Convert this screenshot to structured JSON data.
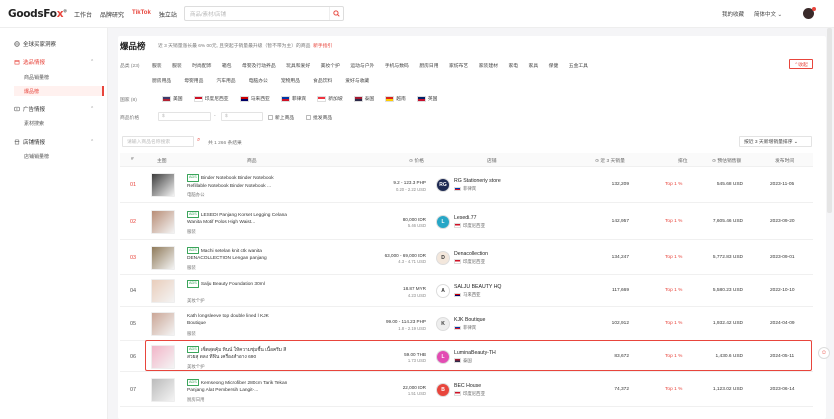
{
  "app": {
    "logo_main": "GoodsFo",
    "logo_accent": "x",
    "logo_tm": "®"
  },
  "topnav": [
    "工作台",
    "品牌研究",
    "TikTok",
    "独立站"
  ],
  "search": {
    "placeholder": "商品/素材/店铺"
  },
  "topright": {
    "favorites": "我的收藏",
    "language": "简体中文 ⌄"
  },
  "sidebar": {
    "items": [
      {
        "label": "全球买家洞察",
        "icon": "globe-icon"
      },
      {
        "label": "选品情报",
        "icon": "box-icon",
        "expanded": true
      },
      {
        "label": "广告情报",
        "icon": "ad-icon",
        "expanded": true
      },
      {
        "label": "店铺情报",
        "icon": "store-icon",
        "expanded": true
      }
    ],
    "sub_product": [
      "商品销量榜",
      "爆品榜"
    ],
    "sub_ads": [
      "素材搜索"
    ],
    "sub_store": [
      "店铺销量榜"
    ]
  },
  "page": {
    "title": "爆品榜",
    "subtitle": "近 3 天销量涨长最 6% 00元, 且突起于销量最升级（暂不带为主）的商品",
    "subtitle_link": "新手指引"
  },
  "filters": {
    "category_label": "品类 (23)",
    "categories_row1": [
      "服装",
      "服装",
      "时尚配饰",
      "箱包",
      "母婴及行动养品",
      "玩具和爱好",
      "美妆个护",
      "运动与户外",
      "手机与数码",
      "厨房日用",
      "家纺布艺",
      "家装建材",
      "家电",
      "家具",
      "保健",
      "五金工具"
    ],
    "categories_row2": [
      "厨房用品",
      "母婴用品",
      "汽车用品",
      "电脑办公",
      "宠物用品",
      "食品饮料",
      "爱好与收藏"
    ],
    "expand_label": "⌃收起",
    "country_label": "国家 (8)",
    "countries": [
      {
        "name": "美国",
        "colors": [
          "#3c3b6e",
          "#b22234"
        ]
      },
      {
        "name": "印度尼西亚",
        "colors": [
          "#ce1126",
          "#ffffff"
        ]
      },
      {
        "name": "马来西亚",
        "colors": [
          "#cc0001",
          "#010066"
        ]
      },
      {
        "name": "菲律宾",
        "colors": [
          "#0038a8",
          "#ce1126"
        ]
      },
      {
        "name": "新加坡",
        "colors": [
          "#ef3340",
          "#ffffff"
        ]
      },
      {
        "name": "泰国",
        "colors": [
          "#a51931",
          "#2d2a4a"
        ]
      },
      {
        "name": "越南",
        "colors": [
          "#da251d",
          "#ffcd00"
        ]
      },
      {
        "name": "英国",
        "colors": [
          "#012169",
          "#c8102e"
        ]
      }
    ],
    "price_label": "商品价格",
    "price_min_placeholder": "$",
    "price_max_placeholder": "$",
    "new_label": "新上商品",
    "agent_label": "批发商品"
  },
  "table": {
    "search_placeholder": "请输入商品名称搜索",
    "count_text": "共 1 266 条结果",
    "sort_label": "按近 3 天新增销量排序 ⌄",
    "headers": {
      "rank": "#",
      "thumb": "主图",
      "product": "商品",
      "price": "⊙ 价格",
      "store": "店铺",
      "sales": "⊙ 近 3 天销量",
      "top": "排位",
      "revenue": "⊙ 预估销售额",
      "date": "发布时间"
    },
    "rows": [
      {
        "rank": "01",
        "tag": "ADS",
        "name": "Binder Notebook Binder Notebook Refillable Notebook Binder Notebook ...",
        "category": "电脑办公",
        "price": "9.2 - 123.3 PHP",
        "price_usd": "0.20 - 2.22 USD",
        "store": "RG Stationeriy store",
        "country": "菲律宾",
        "logo": "RG",
        "logo_color": "#1e2a52",
        "sales": "132,209",
        "top": "Top 1 %",
        "revenue": "545.68 USD",
        "date": "2023-11-05",
        "thumb_color": "#3c3c3c"
      },
      {
        "rank": "02",
        "tag": "ADS",
        "name": "LESEDI Panjang Korset Legging Celana Wanita Motif Polos High Waist...",
        "category": "服装",
        "price": "80,000 IDR",
        "price_usd": "5.46 USD",
        "store": "Lesedi.77",
        "country": "印度尼西亚",
        "logo": "L",
        "logo_color": "#27a6c6",
        "sales": "142,957",
        "top": "Top 1 %",
        "revenue": "7,605.46 USD",
        "date": "2023-09-20",
        "thumb_color": "#b88d76"
      },
      {
        "rank": "03",
        "tag": "ADS",
        "name": "Machi setelan knit ctk wanita DENACOLLECTION Lengan panjang",
        "category": "服装",
        "price": "63,000 - 69,000 IDR",
        "price_usd": "4.3 - 4.71 USD",
        "store": "Denacollection",
        "country": "印度尼西亚",
        "logo": "D",
        "logo_color": "#f3e7dc",
        "sales": "134,247",
        "top": "Top 1 %",
        "revenue": "5,772.83 USD",
        "date": "2023-09-01",
        "thumb_color": "#8f7a5a"
      },
      {
        "rank": "04",
        "tag": "ADS",
        "name": "Salju Beauty Foundation 30ml",
        "category": "美妆个护",
        "price": "18.87 MYR",
        "price_usd": "4.23 USD",
        "store": "SALJU BEAUTY HQ",
        "country": "马来西亚",
        "logo": "A",
        "logo_color": "#ffffff",
        "sales": "117,669",
        "top": "Top 1 %",
        "revenue": "5,580.23 USD",
        "date": "2022-10-10",
        "thumb_color": "#e9cdbb"
      },
      {
        "rank": "05",
        "tag": "",
        "name": "Kath longsleeve top double lined l KJK Boutique",
        "category": "服装",
        "price": "99.00 - 114.23 PHP",
        "price_usd": "1.8 - 2.19 USD",
        "store": "KJK Boutique",
        "country": "菲律宾",
        "logo": "K",
        "logo_color": "#eeeeee",
        "sales": "102,912",
        "top": "Top 1 %",
        "revenue": "1,932.42 USD",
        "date": "2024-04-09",
        "thumb_color": "#caa696"
      },
      {
        "rank": "06",
        "tag": "ADS",
        "name": "เซ็ตสุดคุ้ม ทินน์ ให้ความชุ่มชื้น เนื้อครีม สีสวยสุ ดลง ทีฟิน เครื่องสำอาง 690",
        "category": "美妆个护",
        "price": "59.00 THB",
        "price_usd": "1.73 USD",
        "store": "LuminaBeauty-TH",
        "country": "泰国",
        "logo": "L",
        "logo_color": "#e24cb3",
        "sales": "83,672",
        "top": "Top 1 %",
        "revenue": "1,430.6 USD",
        "date": "2024-05-11",
        "thumb_color": "#f2b5c8"
      },
      {
        "rank": "07",
        "tag": "ADS",
        "name": "Kemseong Microfiber 280cm Tarik Tekan Panjang Alat Pembersih Langit-...",
        "category": "厨房日用",
        "price": "22,000 IDR",
        "price_usd": "1.51 USD",
        "store": "BEC House",
        "country": "印度尼西亚",
        "logo": "B",
        "logo_color": "#e8453c",
        "sales": "74,372",
        "top": "Top 1 %",
        "revenue": "1,123.02 USD",
        "date": "2023-06-14",
        "thumb_color": "#bbbbbb"
      }
    ]
  },
  "colors": {
    "accent": "#e8453c",
    "ads_tag": "#3aa55a"
  }
}
